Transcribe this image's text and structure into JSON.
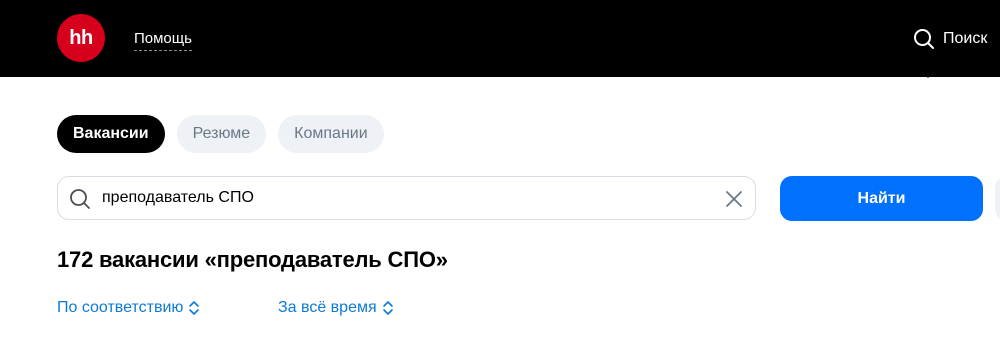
{
  "header": {
    "logo_text": "hh",
    "help_label": "Помощь",
    "search_label": "Поиск",
    "background": "#000000",
    "logo_color": "#d6001c"
  },
  "tabs": [
    {
      "label": "Вакансии",
      "active": true
    },
    {
      "label": "Резюме",
      "active": false
    },
    {
      "label": "Компании",
      "active": false
    }
  ],
  "search": {
    "value": "преподаватель СПО",
    "clear_icon": "close-icon",
    "search_icon": "search-icon"
  },
  "find_button": {
    "label": "Найти",
    "color": "#0070ff"
  },
  "results": {
    "title": "172 вакансии «преподаватель СПО»"
  },
  "filters": {
    "sort_label": "По соответствию",
    "period_label": "За всё время",
    "link_color": "#0d7ad6"
  }
}
